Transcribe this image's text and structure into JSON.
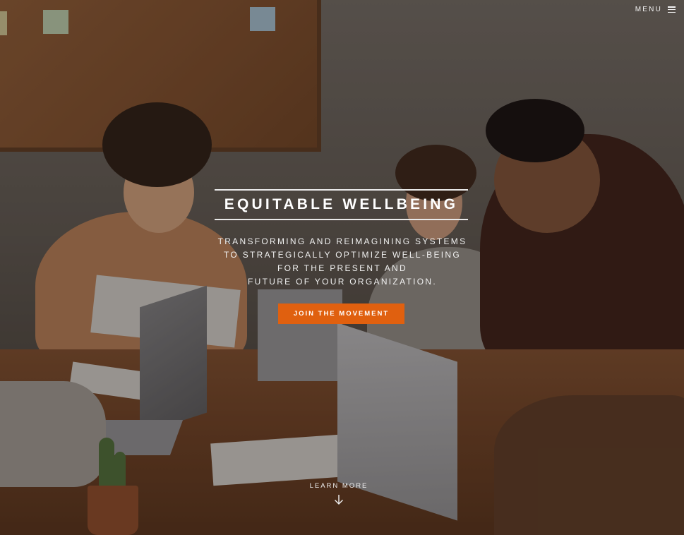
{
  "nav": {
    "menu_label": "MENU",
    "menu_icon": "hamburger-icon"
  },
  "hero": {
    "title": "EQUITABLE WELLBEING",
    "tagline_lines": [
      "TRANSFORMING AND REIMAGINING SYSTEMS",
      "TO STRATEGICALLY OPTIMIZE WELL-BEING",
      "FOR THE PRESENT AND",
      "FUTURE OF YOUR ORGANIZATION."
    ],
    "cta_label": "JOIN THE MOVEMENT",
    "learn_more_label": "LEARN MORE",
    "learn_more_icon": "arrow-down-icon"
  },
  "colors": {
    "accent": "#e0600f",
    "text": "#ffffff",
    "title_rule": "#e9e9e9"
  }
}
